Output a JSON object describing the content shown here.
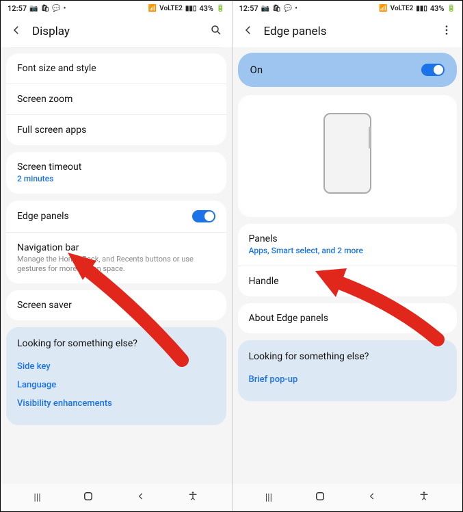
{
  "status": {
    "time": "12:57",
    "battery": "43%",
    "signal_text": "VoLTE2"
  },
  "left": {
    "title": "Display",
    "items": {
      "font": "Font size and style",
      "zoom": "Screen zoom",
      "fullscreen": "Full screen apps",
      "timeout": "Screen timeout",
      "timeout_sub": "2 minutes",
      "edge": "Edge panels",
      "nav": "Navigation bar",
      "nav_sub": "Manage the Home, Back, and Recents buttons or use gestures for more screen space.",
      "saver": "Screen saver"
    },
    "look": {
      "title": "Looking for something else?",
      "links": [
        "Side key",
        "Language",
        "Visibility enhancements"
      ]
    }
  },
  "right": {
    "title": "Edge panels",
    "on_label": "On",
    "items": {
      "panels": "Panels",
      "panels_sub": "Apps, Smart select, and 2 more",
      "handle": "Handle",
      "about": "About Edge panels"
    },
    "look": {
      "title": "Looking for something else?",
      "links": [
        "Brief pop-up"
      ]
    }
  }
}
